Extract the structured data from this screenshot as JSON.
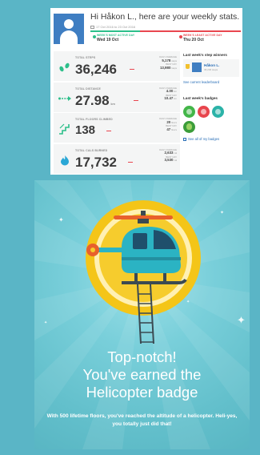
{
  "email": {
    "title": "Hi Håkon L., here are your weekly stats.",
    "date_range": "17 Oct 2016 to 23 Oct 2016",
    "most_active": {
      "label": "WEEK'S MOST ACTIVE DAY",
      "value": "Wed 19 Oct"
    },
    "least_active": {
      "label": "WEEK'S LEAST ACTIVE DAY",
      "value": "Thu 20 Oct"
    },
    "stats": [
      {
        "label": "TOTAL STEPS",
        "value": "36,246",
        "unit": "",
        "avg_label": "DAILY AVERAGE",
        "avg": "5,178",
        "avg_unit": "steps",
        "best_label": "BEST DAY",
        "best": "13,980",
        "best_unit": "steps"
      },
      {
        "label": "TOTAL DISTANCE",
        "value": "27.98",
        "unit": "km",
        "avg_label": "DAILY AVERAGE",
        "avg": "4.00",
        "avg_unit": "km",
        "best_label": "BEST DAY",
        "best": "10.47",
        "best_unit": "km"
      },
      {
        "label": "TOTAL FLOORS CLIMBED",
        "value": "138",
        "unit": "",
        "avg_label": "DAILY AVERAGE",
        "avg": "20",
        "avg_unit": "floors",
        "best_label": "BEST DAY",
        "best": "47",
        "best_unit": "floors"
      },
      {
        "label": "TOTAL CALS BURNED",
        "value": "17,732",
        "unit": "",
        "avg_label": "DAILY AVERAGE",
        "avg": "2,633",
        "avg_unit": "cal",
        "best_label": "BEST DAY",
        "best": "3,530",
        "best_unit": "cal"
      }
    ],
    "winners": {
      "title": "Last week's step winners",
      "name": "Håkon L.",
      "steps": "36,246 steps",
      "link": "See current leaderboard"
    },
    "badges": {
      "title": "Last week's badges",
      "link": "See all of my badges"
    }
  },
  "colors": {
    "page_bg": "#5ab5c6",
    "green": "#2cbf8a",
    "red": "#e9464f",
    "blue": "#2a6fb7"
  },
  "hero": {
    "title_line1": "Top-notch!",
    "title_line2": "You've earned the",
    "title_line3": "Helicopter badge",
    "subtitle": "With 500 lifetime floors, you've reached the altitude of a helicopter. Heli-yes, you totally just did that!"
  }
}
